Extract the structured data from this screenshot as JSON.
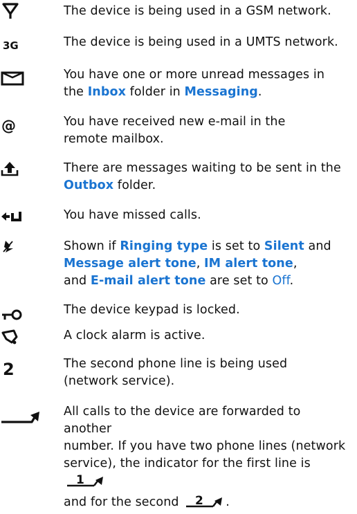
{
  "items": [
    {
      "id": "gsm",
      "icon": "gsm-network-icon",
      "text": "The device is being used in a GSM network."
    },
    {
      "id": "umts",
      "icon": "umts-3g-icon",
      "icon_label": "3G",
      "text": "The device is being used in a UMTS network."
    },
    {
      "id": "unread",
      "icon": "envelope-icon",
      "parts": [
        "You have one or more unread messages in the ",
        "Inbox",
        " folder in ",
        "Messaging",
        "."
      ]
    },
    {
      "id": "email",
      "icon": "at-sign-icon",
      "icon_label": "@",
      "parts": [
        "You have received new e-mail in the",
        "remote mailbox."
      ]
    },
    {
      "id": "outbox",
      "icon": "outbox-upload-icon",
      "parts": [
        "There are messages waiting to be sent in the ",
        "Outbox",
        " folder."
      ]
    },
    {
      "id": "missed",
      "icon": "missed-call-icon",
      "text": "You have missed calls."
    },
    {
      "id": "silent",
      "icon": "silent-bell-icon",
      "parts": [
        "Shown if ",
        "Ringing type",
        " is set to ",
        "Silent",
        " and ",
        "Message alert tone",
        ", ",
        "IM alert tone",
        ",",
        "and ",
        "E-mail alert tone",
        " are set to ",
        "Off",
        "."
      ]
    },
    {
      "id": "keylock",
      "icon": "key-lock-icon",
      "text": "The device keypad is locked."
    },
    {
      "id": "alarm",
      "icon": "alarm-clock-icon",
      "text": "A clock alarm is active."
    },
    {
      "id": "line2",
      "icon": "phone-line-2-icon",
      "icon_label": "2",
      "parts": [
        "The second phone line is being used",
        "(network service)."
      ]
    },
    {
      "id": "forward",
      "icon": "call-forward-icon",
      "parts": [
        "All calls to the device are forwarded to another",
        "number. If you have two phone lines (network",
        "service), the indicator for the first line is ",
        "and for the second ",
        "."
      ],
      "line_numbers": [
        "1",
        "2"
      ]
    }
  ],
  "colors": {
    "text": "#111111",
    "keyword": "#1a74d1"
  }
}
